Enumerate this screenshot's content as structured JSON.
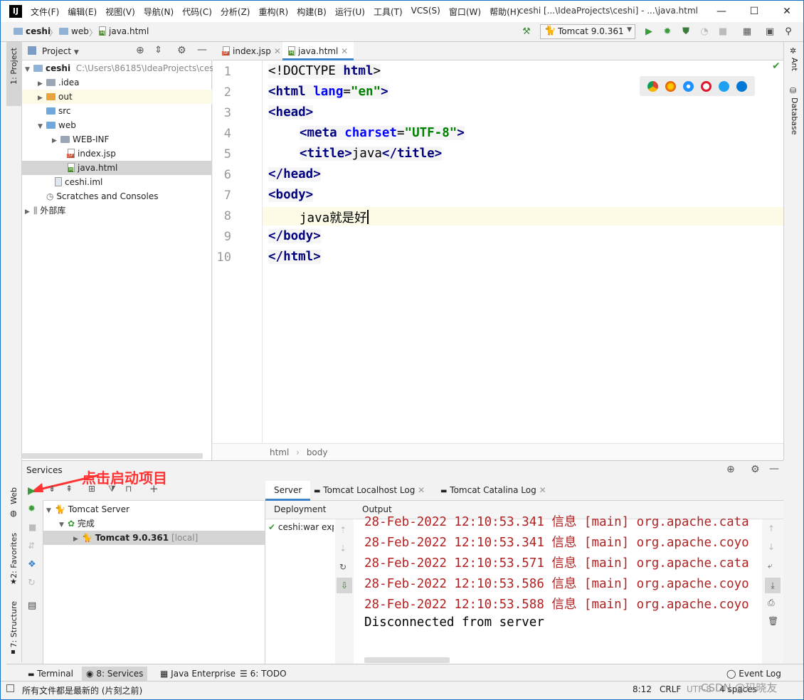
{
  "app": {
    "logo_text": "IJ",
    "window_title": "ceshi [...\\IdeaProjects\\ceshi] - ...\\java.html",
    "menu": [
      "文件(F)",
      "编辑(E)",
      "视图(V)",
      "导航(N)",
      "代码(C)",
      "分析(Z)",
      "重构(R)",
      "构建(B)",
      "运行(U)",
      "工具(T)",
      "VCS(S)",
      "窗口(W)",
      "帮助(H)"
    ],
    "minimize": "—",
    "maximize": "☐",
    "close": "✕"
  },
  "navbar": {
    "breadcrumbs": [
      "ceshi",
      "web",
      "java.html"
    ],
    "run_config": "Tomcat 9.0.361"
  },
  "left_strip": {
    "project": "1: Project",
    "web": "Web",
    "favorites": "2: Favorites",
    "structure": "7: Structure"
  },
  "right_strip": {
    "ant": "Ant",
    "database": "Database"
  },
  "project_panel": {
    "title": "Project",
    "root": {
      "name": "ceshi",
      "path": "C:\\Users\\86185\\IdeaProjects\\ces"
    },
    "items": [
      {
        "name": ".idea"
      },
      {
        "name": "out"
      },
      {
        "name": "src"
      },
      {
        "name": "web"
      },
      {
        "name": "WEB-INF"
      },
      {
        "name": "index.jsp"
      },
      {
        "name": "java.html"
      },
      {
        "name": "ceshi.iml"
      },
      {
        "name": "Scratches and Consoles"
      },
      {
        "name": "外部库"
      }
    ]
  },
  "editor": {
    "tabs": [
      "index.jsp",
      "java.html"
    ],
    "line_numbers": [
      "1",
      "2",
      "3",
      "4",
      "5",
      "6",
      "7",
      "8",
      "9",
      "10"
    ],
    "lines": {
      "l1a": "<!DOCTYPE ",
      "l1b": "html",
      "l1c": ">",
      "l2a": "<html ",
      "l2b": "lang",
      "l2c": "=",
      "l2d": "\"en\"",
      "l2e": ">",
      "l3a": "<head>",
      "l4a": "<meta ",
      "l4b": "charset",
      "l4c": "=",
      "l4d": "\"UTF-8\"",
      "l4e": ">",
      "l5a": "<title>",
      "l5b": "java",
      "l5c": "</title>",
      "l6a": "</head>",
      "l7a": "<body>",
      "l8a": "java就是好",
      "l9a": "</body>",
      "l10a": "</html>"
    },
    "breadcrumb": [
      "html",
      "body"
    ]
  },
  "services": {
    "title": "Services",
    "annotation": "点击启动项目",
    "tree": [
      {
        "name": "Tomcat Server"
      },
      {
        "name": "完成"
      },
      {
        "name": "Tomcat 9.0.361",
        "suffix": "[local]"
      }
    ],
    "tabs": [
      "Server",
      "Tomcat Localhost Log",
      "Tomcat Catalina Log"
    ],
    "deployment_header": "Deployment",
    "deployment_item": "ceshi:war exp",
    "output_header": "Output",
    "log_lines": [
      "28-Feb-2022 12:10:53.341 信息 [main] org.apache.cata",
      "28-Feb-2022 12:10:53.341 信息 [main] org.apache.coyo",
      "28-Feb-2022 12:10:53.571 信息 [main] org.apache.cata",
      "28-Feb-2022 12:10:53.586 信息 [main] org.apache.coyo",
      "28-Feb-2022 12:10:53.588 信息 [main] org.apache.coyo"
    ],
    "disconnected": "Disconnected from server"
  },
  "bottom_tabs": {
    "terminal": "Terminal",
    "services": "8: Services",
    "java_enterprise": "Java Enterprise",
    "todo": "6: TODO",
    "event_log": "Event Log"
  },
  "status": {
    "message": "所有文件都是最新的 (片刻之前)",
    "position": "8:12",
    "line_sep": "CRLF",
    "encoding": "UTF-8",
    "indent": "4 spaces",
    "watermark": "CSDN @玛晓友"
  },
  "colors": {
    "accent": "#4083c9",
    "annotation": "#ff3333",
    "log_text": "#b22222",
    "tag": "#000080",
    "string": "#008000"
  }
}
